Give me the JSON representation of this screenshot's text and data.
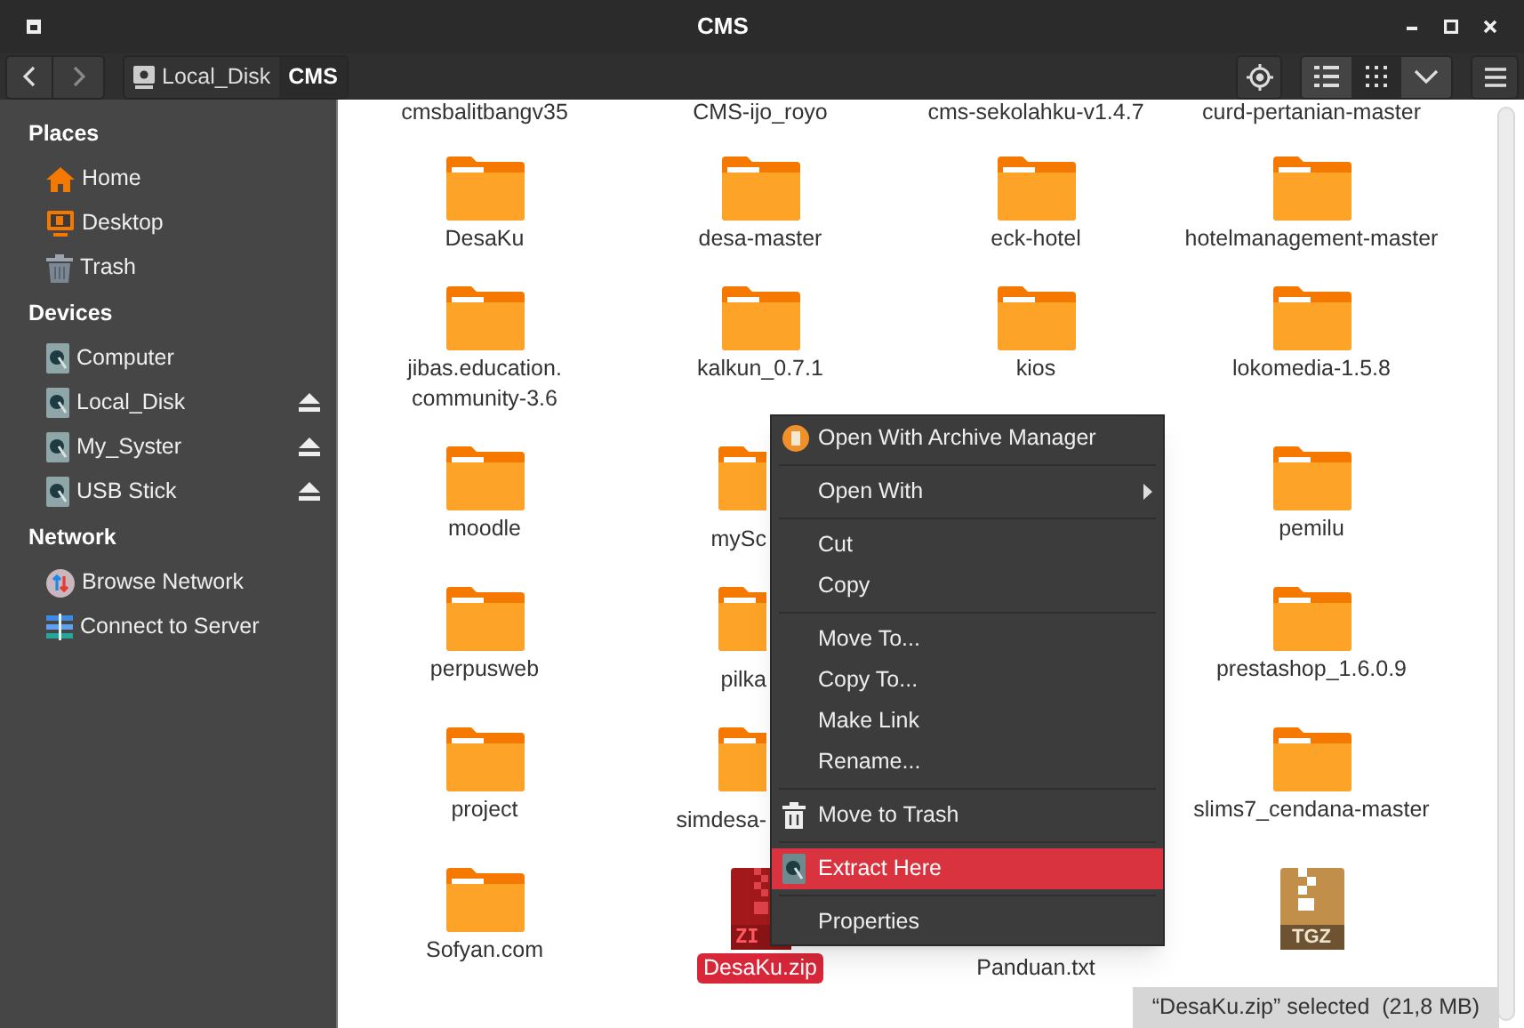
{
  "window": {
    "title": "CMS"
  },
  "breadcrumbs": [
    {
      "label": "Local_Disk",
      "selected": false
    },
    {
      "label": "CMS",
      "selected": true
    }
  ],
  "view_modes": [
    {
      "kind": "list",
      "selected": false
    },
    {
      "kind": "grid",
      "selected": true
    },
    {
      "kind": "more",
      "selected": false
    }
  ],
  "sidebar": [
    {
      "title": "Places",
      "items": [
        {
          "label": "Home",
          "kind": "home",
          "eject": false
        },
        {
          "label": "Desktop",
          "kind": "desktop",
          "eject": false
        },
        {
          "label": "Trash",
          "kind": "trash",
          "eject": false
        }
      ]
    },
    {
      "title": "Devices",
      "items": [
        {
          "label": "Computer",
          "kind": "drive",
          "eject": false
        },
        {
          "label": "Local_Disk",
          "kind": "drive",
          "eject": true
        },
        {
          "label": "My_Syster",
          "kind": "drive",
          "eject": true
        },
        {
          "label": "USB Stick",
          "kind": "drive",
          "eject": true
        }
      ]
    },
    {
      "title": "Network",
      "items": [
        {
          "label": "Browse Network",
          "kind": "network",
          "eject": false
        },
        {
          "label": "Connect to Server",
          "kind": "server",
          "eject": false
        }
      ]
    }
  ],
  "partial_row": [
    "cmsbalitbangv35",
    "CMS-ijo_royo",
    "cms-sekolahku-v1.4.7",
    "curd-pertanian-master"
  ],
  "files": [
    {
      "name": "DesaKu",
      "kind": "folder",
      "selected": false
    },
    {
      "name": "desa-master",
      "kind": "folder",
      "selected": false
    },
    {
      "name": "eck-hotel",
      "kind": "folder",
      "selected": false
    },
    {
      "name": "hotelmanagement-master",
      "kind": "folder",
      "selected": false
    },
    {
      "name": "jibas.education. community-3.6",
      "kind": "folder",
      "selected": false
    },
    {
      "name": "kalkun_0.7.1",
      "kind": "folder",
      "selected": false
    },
    {
      "name": "kios",
      "kind": "folder",
      "selected": false
    },
    {
      "name": "lokomedia-1.5.8",
      "kind": "folder",
      "selected": false
    },
    {
      "name": "moodle",
      "kind": "folder",
      "selected": false
    },
    {
      "name": "mySc",
      "kind": "folder_partial"
    },
    {
      "kind": "hidden"
    },
    {
      "name": "pemilu",
      "kind": "folder",
      "selected": false
    },
    {
      "name": "perpusweb",
      "kind": "folder",
      "selected": false
    },
    {
      "name": "pilka",
      "kind": "folder_partial"
    },
    {
      "kind": "hidden"
    },
    {
      "name": "prestashop_1.6.0.9",
      "kind": "folder",
      "selected": false
    },
    {
      "name": "project",
      "kind": "folder",
      "selected": false
    },
    {
      "name": "simdesa-",
      "kind": "folder_partial"
    },
    {
      "kind": "hidden"
    },
    {
      "name": "slims7_cendana-master",
      "kind": "folder",
      "selected": false
    },
    {
      "name": "Sofyan.com",
      "kind": "folder",
      "selected": false
    },
    {
      "name": "DesaKu.zip",
      "kind": "zip",
      "badge": "ZI",
      "selected": true
    },
    {
      "name": "Panduan.txt",
      "kind": "text",
      "selected": false
    },
    {
      "kind": "tgz",
      "badge": "TGZ"
    }
  ],
  "context_menu": [
    {
      "kind": "archive",
      "label": "Open With Archive Manager",
      "submenu": false,
      "selected": false
    },
    {
      "kind": "separator"
    },
    {
      "kind": "plain",
      "label": "Open With",
      "submenu": true,
      "selected": false
    },
    {
      "kind": "separator"
    },
    {
      "kind": "plain",
      "label": "Cut",
      "submenu": false,
      "selected": false
    },
    {
      "kind": "plain",
      "label": "Copy",
      "submenu": false,
      "selected": false
    },
    {
      "kind": "separator"
    },
    {
      "kind": "plain",
      "label": "Move To...",
      "submenu": false,
      "selected": false
    },
    {
      "kind": "plain",
      "label": "Copy To...",
      "submenu": false,
      "selected": false
    },
    {
      "kind": "plain",
      "label": "Make Link",
      "submenu": false,
      "selected": false
    },
    {
      "kind": "plain",
      "label": "Rename...",
      "submenu": false,
      "selected": false
    },
    {
      "kind": "separator"
    },
    {
      "kind": "trash",
      "label": "Move to Trash",
      "submenu": false,
      "selected": false
    },
    {
      "kind": "separator"
    },
    {
      "kind": "drive",
      "label": "Extract Here",
      "submenu": false,
      "selected": true
    },
    {
      "kind": "separator"
    },
    {
      "kind": "plain",
      "label": "Properties",
      "submenu": false,
      "selected": false
    }
  ],
  "status_bar": "“DesaKu.zip” selected  (21,8 MB)"
}
